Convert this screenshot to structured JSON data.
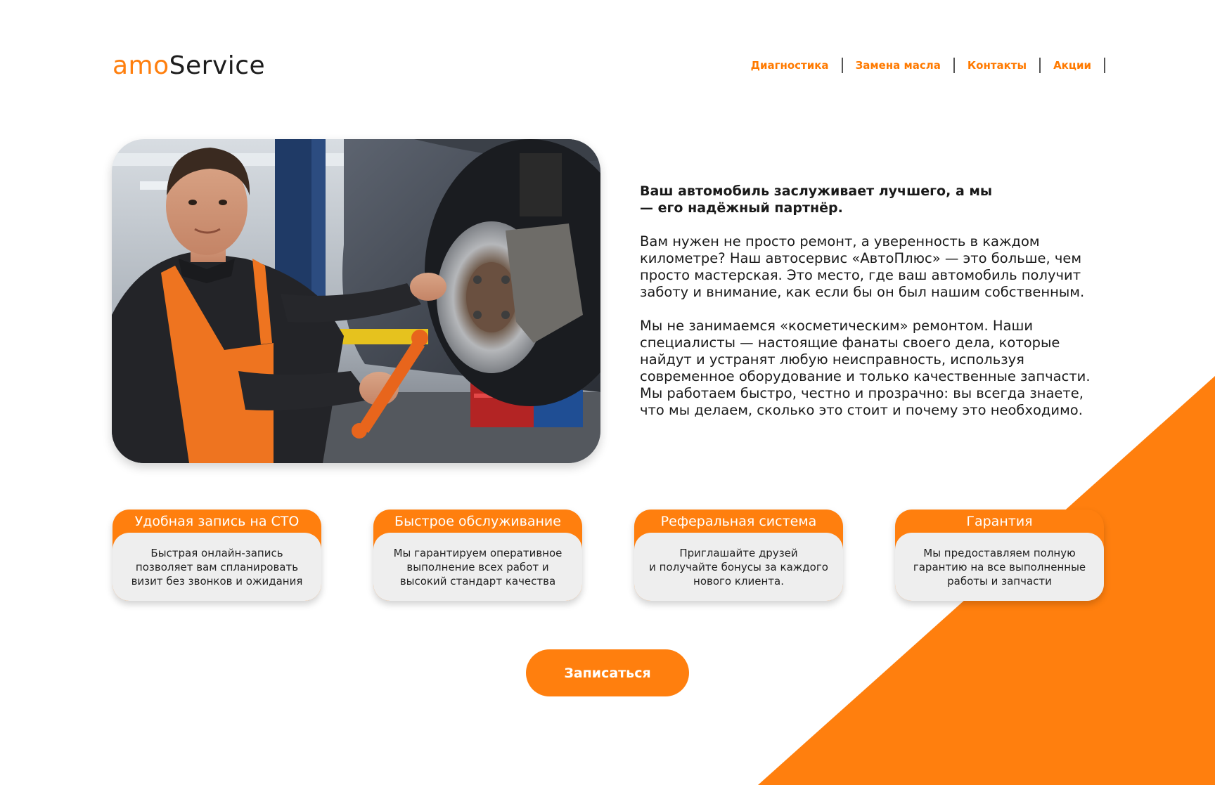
{
  "colors": {
    "accent": "#ff7f0e",
    "text": "#1a1a1a",
    "card_body": "#eeeeee"
  },
  "header": {
    "logo_prefix": "amo",
    "logo_suffix": "Service",
    "nav": [
      {
        "label": "Диагностика"
      },
      {
        "label": "Замена масла"
      },
      {
        "label": "Контакты"
      },
      {
        "label": "Акции"
      }
    ]
  },
  "hero": {
    "image": "mechanic-photo",
    "lead": "Ваш автомобиль заслуживает лучшего, а мы\n — его надёжный партнёр.",
    "paragraph1": "Вам нужен не просто ремонт, а уверенность в каждом\nкилометре? Наш автосервис «АвтоПлюс» — это больше, чем\nпросто мастерская. Это место, где ваш автомобиль получит\nзаботу и внимание, как если бы он был нашим собственным.",
    "paragraph2": "Мы не занимаемся «косметическим» ремонтом. Наши\nспециалисты — настоящие фанаты своего дела, которые\nнайдут и устранят любую неисправность, используя\nсовременное оборудование и только качественные запчасти.\nМы работаем быстро, честно и прозрачно: вы всегда знаете,\nчто мы делаем, сколько это стоит и почему это необходимо."
  },
  "features": [
    {
      "title": "Удобная запись на СТО",
      "text": "Быстрая онлайн-запись\nпозволяет вам спланировать\nвизит без звонков и ожидания"
    },
    {
      "title": "Быстрое обслуживание",
      "text": "Мы гарантируем оперативное\nвыполнение всех работ и\nвысокий стандарт качества"
    },
    {
      "title": "Реферальная система",
      "text": "Приглашайте друзей\nи получайте бонусы за каждого\nнового клиента."
    },
    {
      "title": "Гарантия",
      "text": "Мы предоставляем полную\nгарантию на все выполненные\nработы и запчасти"
    }
  ],
  "cta": {
    "label": "Записаться"
  }
}
